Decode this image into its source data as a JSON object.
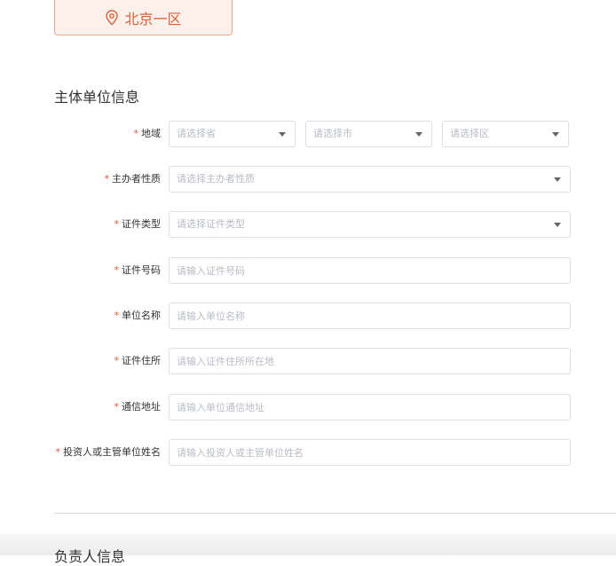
{
  "region": {
    "label": "北京一区"
  },
  "section": {
    "title": "主体单位信息"
  },
  "form": {
    "required_mark": "*",
    "region_label": "地域",
    "province_placeholder": "请选择省",
    "city_placeholder": "请选择市",
    "district_placeholder": "请选择区",
    "sponsor_nature_label": "主办者性质",
    "sponsor_nature_placeholder": "请选择主办者性质",
    "cert_type_label": "证件类型",
    "cert_type_placeholder": "请选择证件类型",
    "cert_number_label": "证件号码",
    "cert_number_placeholder": "请输入证件号码",
    "unit_name_label": "单位名称",
    "unit_name_placeholder": "请输入单位名称",
    "cert_address_label": "证件住所",
    "cert_address_placeholder": "请输入证件住所所在地",
    "mail_address_label": "通信地址",
    "mail_address_placeholder": "请输入单位通信地址",
    "investor_label": "投资人或主管单位姓名",
    "investor_placeholder": "请输入投资人或主管单位姓名"
  },
  "next_section": {
    "title": "负责人信息"
  },
  "colors": {
    "accent": "#e0573b",
    "region_bg": "#fdf0ea",
    "region_border": "#e3a98f"
  }
}
